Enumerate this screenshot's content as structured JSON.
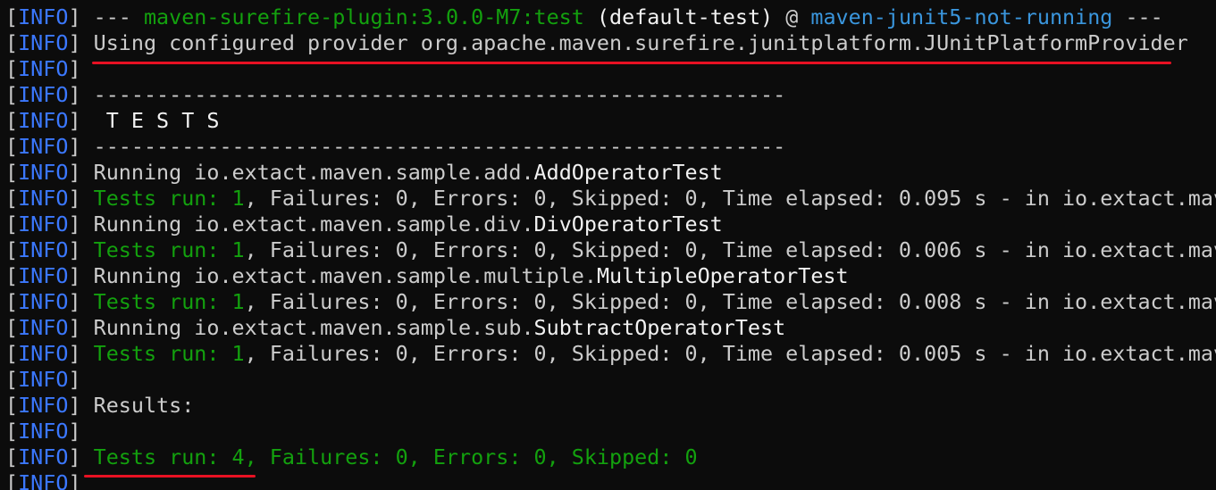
{
  "log_level": "INFO",
  "header": {
    "dashes_left": "---",
    "plugin": "maven-surefire-plugin:3.0.0-M7:test",
    "execution": "(default-test)",
    "at": "@",
    "project": "maven-junit5-not-running",
    "dashes_right": "---"
  },
  "provider_line": "Using configured provider org.apache.maven.surefire.junitplatform.JUnitPlatformProvider",
  "separator": "-------------------------------------------------------",
  "tests_heading": " T E S T S",
  "test_classes": [
    {
      "package": "io.extact.maven.sample.add.",
      "class_name": "AddOperatorTest",
      "tests_run_label": "Tests run: 1",
      "rest": ", Failures: 0, Errors: 0, Skipped: 0, Time elapsed: 0.095 s - in io.extact.mav"
    },
    {
      "package": "io.extact.maven.sample.div.",
      "class_name": "DivOperatorTest",
      "tests_run_label": "Tests run: 1",
      "rest": ", Failures: 0, Errors: 0, Skipped: 0, Time elapsed: 0.006 s - in io.extact.mav"
    },
    {
      "package": "io.extact.maven.sample.multiple.",
      "class_name": "MultipleOperatorTest",
      "tests_run_label": "Tests run: 1",
      "rest": ", Failures: 0, Errors: 0, Skipped: 0, Time elapsed: 0.008 s - in io.extact.mav"
    },
    {
      "package": "io.extact.maven.sample.sub.",
      "class_name": "SubtractOperatorTest",
      "tests_run_label": "Tests run: 1",
      "rest": ", Failures: 0, Errors: 0, Skipped: 0, Time elapsed: 0.005 s - in io.extact.mav"
    }
  ],
  "running_prefix": "Running ",
  "results_label": "Results:",
  "summary_line": "Tests run: 4, Failures: 0, Errors: 0, Skipped: 0",
  "colors": {
    "background": "#0c0c0c",
    "info": "#3b78ff",
    "green": "#13a10e",
    "blue": "#3a96dd",
    "text": "#cccccc",
    "bright": "#f2f2f2",
    "annotation": "#e81123"
  }
}
